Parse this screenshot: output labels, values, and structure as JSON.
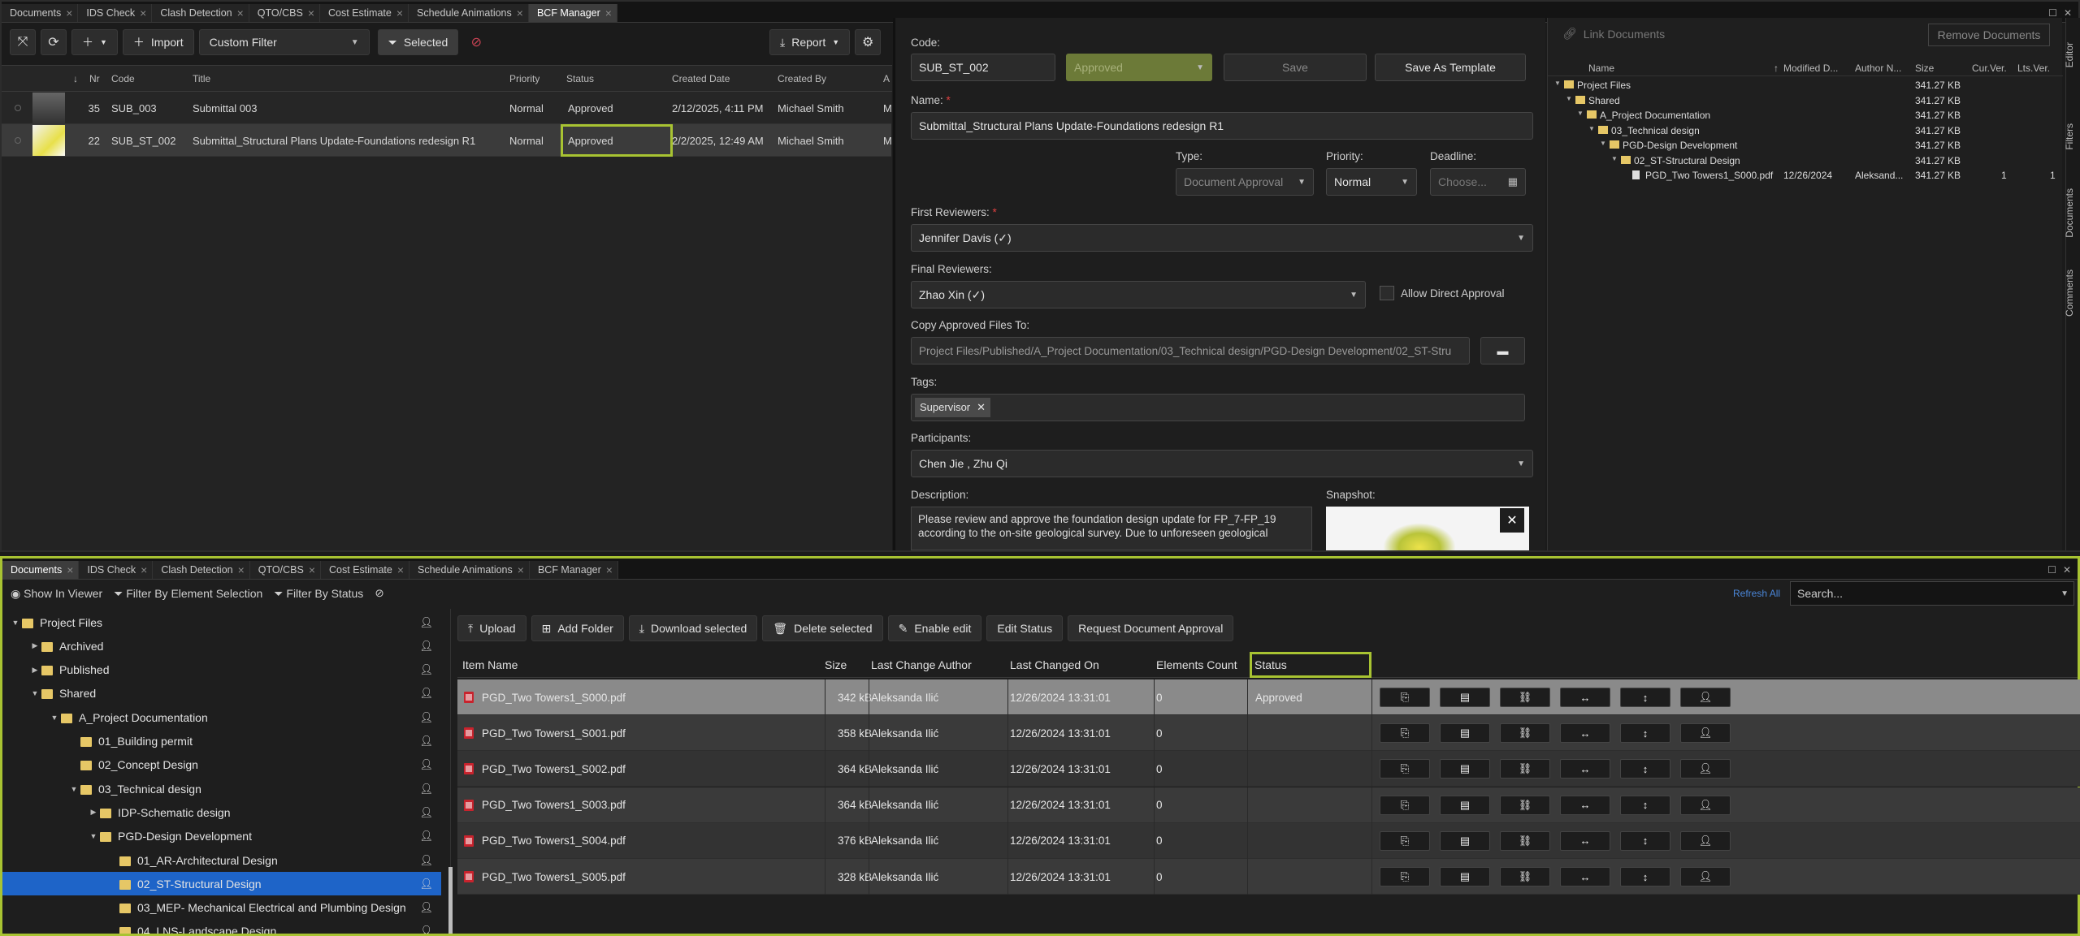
{
  "top_tabs": [
    "Documents",
    "IDS Check",
    "Clash Detection",
    "QTO/CBS",
    "Cost Estimate",
    "Schedule Animations",
    "BCF Manager"
  ],
  "top_tabs_active": "BCF Manager",
  "bottom_tabs": [
    "Documents",
    "IDS Check",
    "Clash Detection",
    "QTO/CBS",
    "Cost Estimate",
    "Schedule Animations",
    "BCF Manager"
  ],
  "bottom_tabs_active": "Documents",
  "bcf_toolbar": {
    "import": "Import",
    "filter": "Custom Filter",
    "selected": "Selected",
    "report": "Report"
  },
  "bcf_grid": {
    "headers": [
      "Nr",
      "Code",
      "Title",
      "Priority",
      "Status",
      "Created Date",
      "Created By",
      "A"
    ],
    "rows": [
      {
        "nr": "35",
        "code": "SUB_003",
        "title": "Submittal 003",
        "priority": "Normal",
        "status": "Approved",
        "created": "2/12/2025, 4:11 PM",
        "by": "Michael Smith",
        "a": "M"
      },
      {
        "nr": "22",
        "code": "SUB_ST_002",
        "title": "Submittal_Structural Plans Update-Foundations redesign R1",
        "priority": "Normal",
        "status": "Approved",
        "created": "2/2/2025, 12:49 AM",
        "by": "Michael Smith",
        "a": "M"
      }
    ]
  },
  "form": {
    "code_label": "Code:",
    "code": "SUB_ST_002",
    "status": "Approved",
    "save": "Save",
    "save_template": "Save As Template",
    "name_label": "Name:",
    "name": "Submittal_Structural Plans Update-Foundations redesign R1",
    "type_label": "Type:",
    "type": "Document Approval",
    "priority_label": "Priority:",
    "priority": "Normal",
    "deadline_label": "Deadline:",
    "deadline_placeholder": "Choose...",
    "first_label": "First Reviewers:",
    "first": "Jennifer Davis (✓)",
    "final_label": "Final Reviewers:",
    "final": "Zhao  Xin (✓)",
    "allow_direct": "Allow Direct Approval",
    "copy_label": "Copy Approved Files To:",
    "copy_path": "Project Files/Published/A_Project Documentation/03_Technical design/PGD-Design Development/02_ST-Stru",
    "tags_label": "Tags:",
    "tag": "Supervisor",
    "participants_label": "Participants:",
    "participants": "Chen  Jie , Zhu  Qi",
    "desc_label": "Description:",
    "description": "Please review and approve the foundation design update for FP_7-FP_19 according to the on-site geological survey. Due to unforeseen geological",
    "snapshot_label": "Snapshot:"
  },
  "linked": {
    "link_btn": "Link Documents",
    "remove_btn": "Remove Documents",
    "headers": [
      "Name",
      "Modified D...",
      "Author N...",
      "Size",
      "Cur.Ver.",
      "Lts.Ver."
    ],
    "tree": [
      {
        "name": "Project Files",
        "size": "341.27 KB"
      },
      {
        "name": "Shared",
        "size": "341.27 KB"
      },
      {
        "name": "A_Project Documentation",
        "size": "341.27 KB"
      },
      {
        "name": "03_Technical design",
        "size": "341.27 KB"
      },
      {
        "name": "PGD-Design Development",
        "size": "341.27 KB"
      },
      {
        "name": "02_ST-Structural Design",
        "size": "341.27 KB"
      },
      {
        "name": "PGD_Two Towers1_S000.pdf",
        "modified": "12/26/2024",
        "author": "Aleksand...",
        "size": "341.27 KB",
        "cur": "1",
        "lts": "1"
      }
    ]
  },
  "side_tabs": [
    "Editor",
    "Filters",
    "Documents",
    "Comments"
  ],
  "doc_toolbar": {
    "show": "Show In Viewer",
    "filter_sel": "Filter By Element Selection",
    "filter_status": "Filter By Status",
    "refresh": "Refresh All",
    "search_placeholder": "Search..."
  },
  "folder_tree": [
    {
      "name": "Project Files",
      "level": 0,
      "arrow": "▼"
    },
    {
      "name": "Archived",
      "level": 1,
      "arrow": "▶"
    },
    {
      "name": "Published",
      "level": 1,
      "arrow": "▶"
    },
    {
      "name": "Shared",
      "level": 1,
      "arrow": "▼"
    },
    {
      "name": "A_Project Documentation",
      "level": 2,
      "arrow": "▼"
    },
    {
      "name": "01_Building permit",
      "level": 3,
      "arrow": ""
    },
    {
      "name": "02_Concept Design",
      "level": 3,
      "arrow": ""
    },
    {
      "name": "03_Technical design",
      "level": 3,
      "arrow": "▼"
    },
    {
      "name": "IDP-Schematic design",
      "level": 4,
      "arrow": "▶"
    },
    {
      "name": "PGD-Design Development",
      "level": 4,
      "arrow": "▼"
    },
    {
      "name": "01_AR-Architectural Design",
      "level": 5,
      "arrow": ""
    },
    {
      "name": "02_ST-Structural Design",
      "level": 5,
      "arrow": "",
      "selected": true
    },
    {
      "name": "03_MEP- Mechanical Electrical and Plumbing Design",
      "level": 5,
      "arrow": ""
    },
    {
      "name": "04_LNS-Landscape Design",
      "level": 5,
      "arrow": ""
    }
  ],
  "doc_actions": {
    "upload": "Upload",
    "add_folder": "Add Folder",
    "download": "Download selected",
    "delete": "Delete selected",
    "enable_edit": "Enable edit",
    "edit_status": "Edit Status",
    "request": "Request Document Approval"
  },
  "doc_headers": [
    "Item Name",
    "Size",
    "Last Change Author",
    "Last Changed On",
    "Elements Count",
    "Status"
  ],
  "doc_rows": [
    {
      "name": "PGD_Two Towers1_S000.pdf",
      "size": "342 kB",
      "author": "Aleksanda Ilić",
      "date": "12/26/2024 13:31:01",
      "count": "0",
      "status": "Approved"
    },
    {
      "name": "PGD_Two Towers1_S001.pdf",
      "size": "358 kB",
      "author": "Aleksanda Ilić",
      "date": "12/26/2024 13:31:01",
      "count": "0",
      "status": ""
    },
    {
      "name": "PGD_Two Towers1_S002.pdf",
      "size": "364 kB",
      "author": "Aleksanda Ilić",
      "date": "12/26/2024 13:31:01",
      "count": "0",
      "status": ""
    },
    {
      "name": "PGD_Two Towers1_S003.pdf",
      "size": "364 kB",
      "author": "Aleksanda Ilić",
      "date": "12/26/2024 13:31:01",
      "count": "0",
      "status": ""
    },
    {
      "name": "PGD_Two Towers1_S004.pdf",
      "size": "376 kB",
      "author": "Aleksanda Ilić",
      "date": "12/26/2024 13:31:01",
      "count": "0",
      "status": ""
    },
    {
      "name": "PGD_Two Towers1_S005.pdf",
      "size": "328 kB",
      "author": "Aleksanda Ilić",
      "date": "12/26/2024 13:31:01",
      "count": "0",
      "status": ""
    }
  ],
  "colors": {
    "accent_green": "#a8c332",
    "selected_blue": "#1e64c8",
    "folder": "#e6c766"
  }
}
